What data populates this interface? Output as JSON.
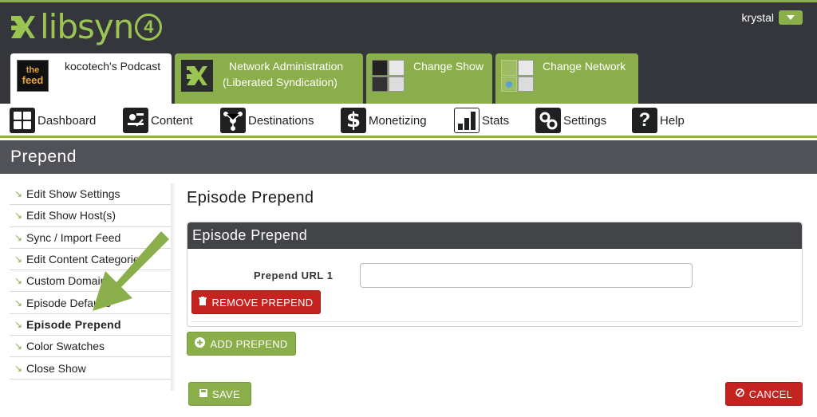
{
  "header": {
    "logo_text": "libsyn",
    "logo_badge": "4",
    "user_name": "krystal"
  },
  "tabs": [
    {
      "label_line1": "kocotech's Podcast",
      "label_line2": "",
      "active": true,
      "thumb_text_1": "the",
      "thumb_text_2": "feed"
    },
    {
      "label_line1": "Network Administration",
      "label_line2": "(Liberated Syndication)",
      "active": false
    },
    {
      "label_line1": "Change Show",
      "label_line2": "",
      "active": false
    },
    {
      "label_line1": "Change Network",
      "label_line2": "",
      "active": false
    }
  ],
  "nav": {
    "items": [
      {
        "label": "Dashboard",
        "icon": "dashboard-icon"
      },
      {
        "label": "Content",
        "icon": "content-icon"
      },
      {
        "label": "Destinations",
        "icon": "destinations-icon"
      },
      {
        "label": "Monetizing",
        "icon": "dollar-icon"
      },
      {
        "label": "Stats",
        "icon": "bar-chart-icon"
      },
      {
        "label": "Settings",
        "icon": "gears-icon"
      },
      {
        "label": "Help",
        "icon": "question-icon"
      }
    ]
  },
  "page": {
    "title": "Prepend",
    "heading": "Episode Prepend"
  },
  "sidebar": {
    "items": [
      {
        "label": "Edit Show Settings",
        "active": false
      },
      {
        "label": "Edit Show Host(s)",
        "active": false
      },
      {
        "label": "Sync / Import Feed",
        "active": false
      },
      {
        "label": "Edit Content Categories",
        "active": false
      },
      {
        "label": "Custom Domain",
        "active": false
      },
      {
        "label": "Episode Defaults",
        "active": false
      },
      {
        "label": "Episode Prepend",
        "active": true
      },
      {
        "label": "Color Swatches",
        "active": false
      },
      {
        "label": "Close Show",
        "active": false
      }
    ]
  },
  "panel": {
    "title": "Episode Prepend",
    "field_label": "Prepend URL 1",
    "field_value": "",
    "remove_label": "REMOVE PREPEND",
    "add_label": "ADD PREPEND"
  },
  "actions": {
    "save_label": "SAVE",
    "cancel_label": "CANCEL"
  },
  "colors": {
    "brand_green": "#8aae4a",
    "header_dark": "#34363b",
    "danger_red": "#c4231f"
  }
}
